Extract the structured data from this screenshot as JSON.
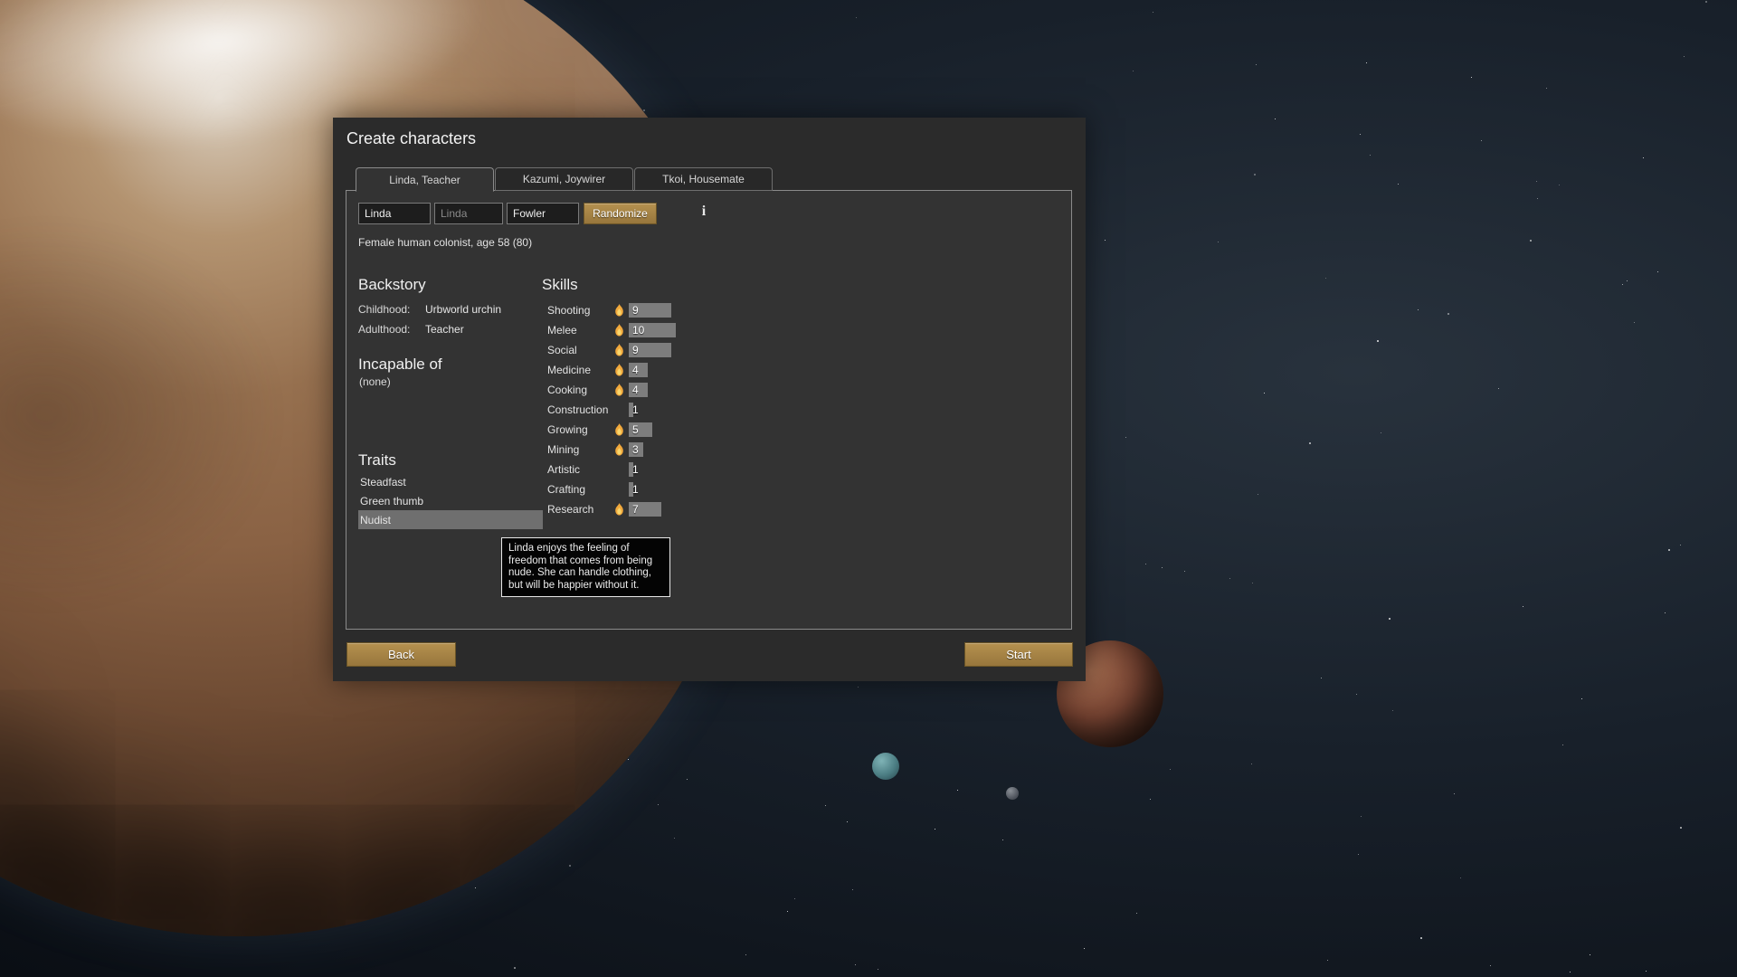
{
  "dialog": {
    "title": "Create characters",
    "tabs": [
      {
        "label": "Linda, Teacher",
        "active": true
      },
      {
        "label": "Kazumi, Joywirer",
        "active": false
      },
      {
        "label": "Tkoi, Housemate",
        "active": false
      }
    ],
    "name_fields": {
      "first": "Linda",
      "nick": "Linda",
      "last": "Fowler"
    },
    "randomize_label": "Randomize",
    "summary": "Female human colonist, age 58 (80)",
    "backstory": {
      "heading": "Backstory",
      "rows": [
        {
          "label": "Childhood:",
          "value": "Urbworld urchin"
        },
        {
          "label": "Adulthood:",
          "value": "Teacher"
        }
      ]
    },
    "incapable": {
      "heading": "Incapable of",
      "value": "(none)"
    },
    "traits": {
      "heading": "Traits",
      "items": [
        {
          "label": "Steadfast",
          "highlighted": false
        },
        {
          "label": "Green thumb",
          "highlighted": false
        },
        {
          "label": "Nudist",
          "highlighted": true
        }
      ]
    },
    "skills": {
      "heading": "Skills",
      "items": [
        {
          "name": "Shooting",
          "value": 9,
          "passion": true
        },
        {
          "name": "Melee",
          "value": 10,
          "passion": true
        },
        {
          "name": "Social",
          "value": 9,
          "passion": true
        },
        {
          "name": "Medicine",
          "value": 4,
          "passion": true
        },
        {
          "name": "Cooking",
          "value": 4,
          "passion": true
        },
        {
          "name": "Construction",
          "value": 1,
          "passion": false
        },
        {
          "name": "Growing",
          "value": 5,
          "passion": true
        },
        {
          "name": "Mining",
          "value": 3,
          "passion": true
        },
        {
          "name": "Artistic",
          "value": 1,
          "passion": false
        },
        {
          "name": "Crafting",
          "value": 1,
          "passion": false
        },
        {
          "name": "Research",
          "value": 7,
          "passion": true
        }
      ]
    },
    "tooltip": "Linda enjoys the feeling of freedom that comes from being nude. She can handle clothing, but will be happier without it.",
    "back_label": "Back",
    "start_label": "Start"
  },
  "colors": {
    "accent": "#b5914f",
    "panel": "#333333",
    "passion_flame": "#f2a93c"
  }
}
